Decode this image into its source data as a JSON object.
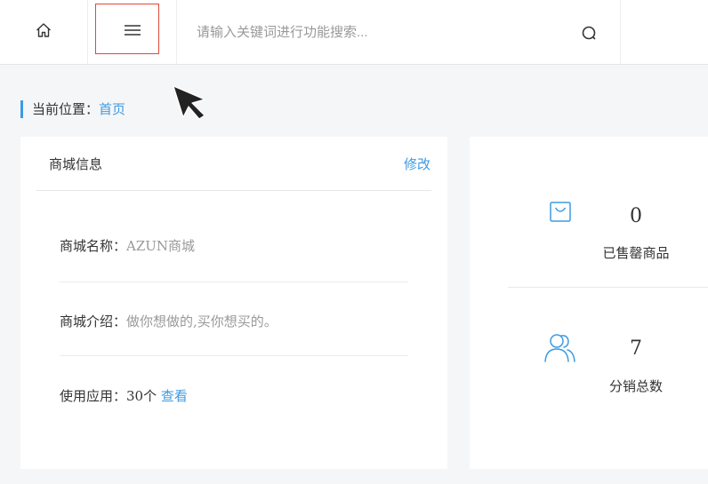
{
  "header": {
    "home_icon": "home-icon",
    "menu_icon": "hamburger-menu-icon",
    "search_placeholder": "请输入关键词进行功能搜索...",
    "search_icon": "search-icon"
  },
  "breadcrumb": {
    "prefix": "当前位置：",
    "current": "首页"
  },
  "mall_info": {
    "title": "商城信息",
    "edit_label": "修改",
    "name_label": "商城名称：",
    "name_value": "AZUN商城",
    "intro_label": "商城介绍：",
    "intro_value": "做你想做的,买你想买的。",
    "apps_label": "使用应用：",
    "apps_value": "30个",
    "apps_link": "查看"
  },
  "stats": [
    {
      "icon": "shopping-bag-icon",
      "value": "0",
      "label": "已售罄商品"
    },
    {
      "icon": "users-icon",
      "value": "7",
      "label": "分销总数"
    }
  ],
  "colors": {
    "accent": "#3d9be2",
    "highlight_border": "#e0483a",
    "background": "#f5f6f8"
  }
}
